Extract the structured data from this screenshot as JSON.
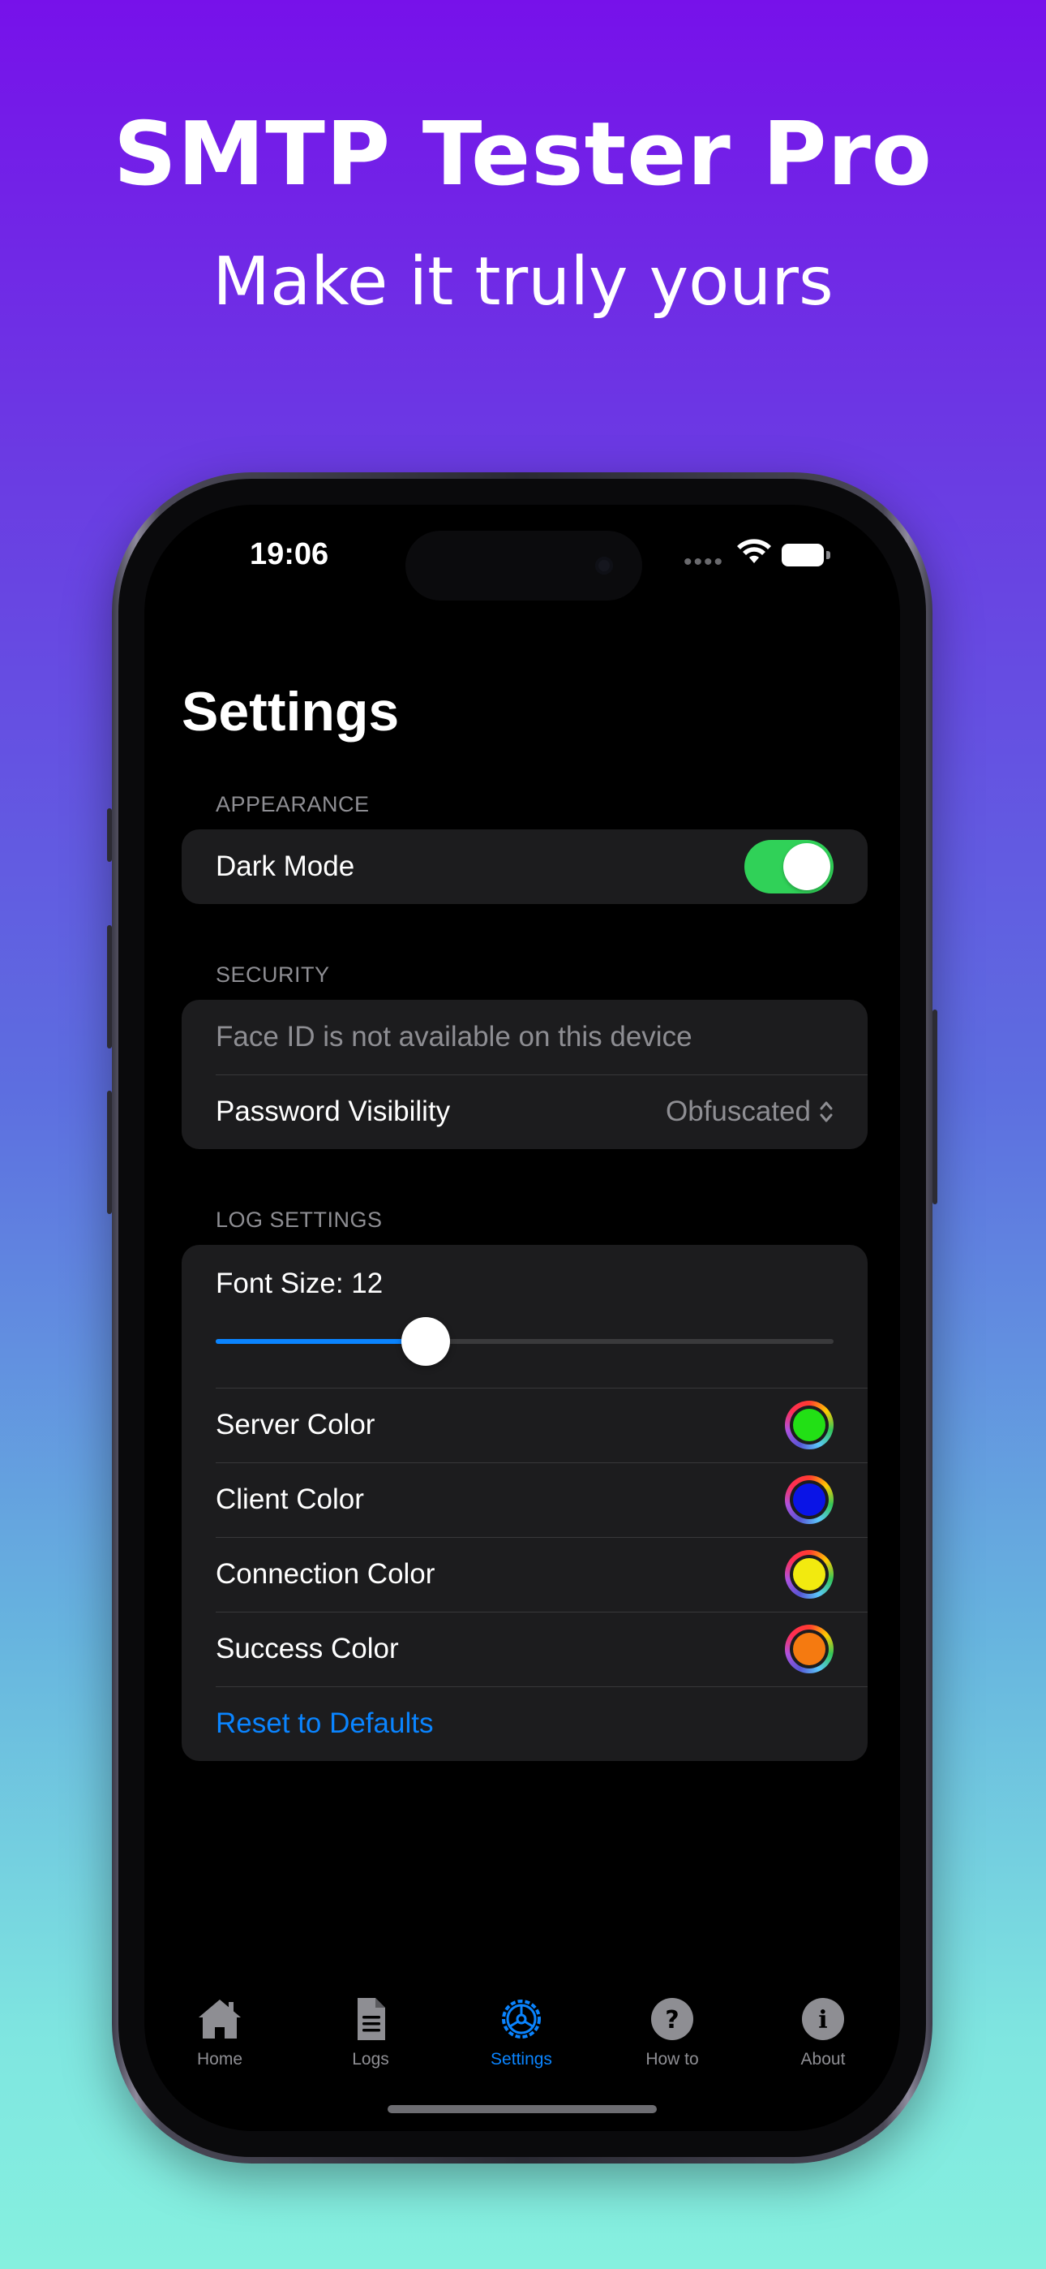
{
  "promo": {
    "title": "SMTP Tester Pro",
    "subtitle": "Make it truly yours"
  },
  "status_bar": {
    "time": "19:06"
  },
  "settings": {
    "title": "Settings",
    "appearance": {
      "header": "APPEARANCE",
      "dark_mode_label": "Dark Mode",
      "dark_mode_on": true
    },
    "security": {
      "header": "SECURITY",
      "face_id_message": "Face ID is not available on this device",
      "password_visibility_label": "Password Visibility",
      "password_visibility_value": "Obfuscated"
    },
    "log_settings": {
      "header": "LOG SETTINGS",
      "font_size_label": "Font Size: 12",
      "font_size_slider_fraction": 0.34,
      "colors": [
        {
          "label": "Server Color",
          "color": "#22e015"
        },
        {
          "label": "Client Color",
          "color": "#0a14e6"
        },
        {
          "label": "Connection Color",
          "color": "#f2ea0f"
        },
        {
          "label": "Success Color",
          "color": "#f57a10"
        }
      ],
      "reset_label": "Reset to Defaults"
    }
  },
  "tab_bar": {
    "tabs": [
      {
        "label": "Home",
        "icon": "house-icon",
        "active": false
      },
      {
        "label": "Logs",
        "icon": "doc-text-icon",
        "active": false
      },
      {
        "label": "Settings",
        "icon": "gear-icon",
        "active": true
      },
      {
        "label": "How to",
        "icon": "question-circle-icon",
        "active": false
      },
      {
        "label": "About",
        "icon": "info-circle-icon",
        "active": false
      }
    ]
  },
  "colors": {
    "accent": "#0a84ff",
    "toggle_on": "#30d158"
  }
}
